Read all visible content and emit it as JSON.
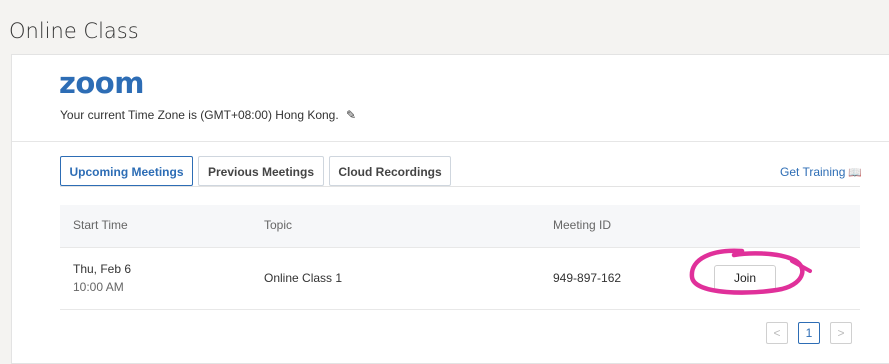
{
  "top_cut_text": "                                                                                       ",
  "page_title": "Online Class",
  "logo_text": "zoom",
  "timezone_text": "Your current Time Zone is (GMT+08:00) Hong Kong.",
  "tabs": [
    {
      "label": "Upcoming Meetings",
      "active": true
    },
    {
      "label": "Previous Meetings",
      "active": false
    },
    {
      "label": "Cloud Recordings",
      "active": false
    }
  ],
  "get_training": "Get Training",
  "table": {
    "headers": [
      "Start Time",
      "Topic",
      "Meeting ID"
    ],
    "rows": [
      {
        "date": "Thu, Feb 6",
        "time": "10:00 AM",
        "topic": "Online Class 1",
        "meeting_id": "949-897-162",
        "action": "Join"
      }
    ]
  },
  "pagination": {
    "prev": "<",
    "current": "1",
    "next": ">"
  },
  "colors": {
    "accent": "#2d6db5",
    "highlight_circle": "#e0309a"
  }
}
